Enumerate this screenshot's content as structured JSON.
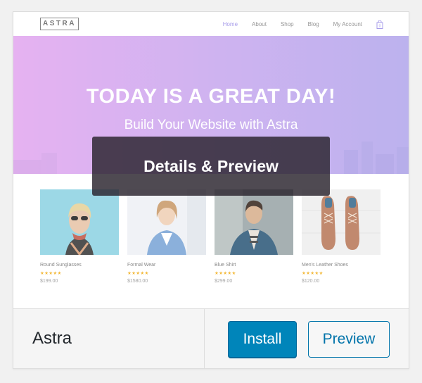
{
  "theme": {
    "name": "Astra"
  },
  "overlay": {
    "label": "Details & Preview"
  },
  "buttons": {
    "install": "Install",
    "preview": "Preview"
  },
  "site": {
    "logo": "ASTRA",
    "nav": [
      "Home",
      "About",
      "Shop",
      "Blog",
      "My Account"
    ],
    "hero_title": "TODAY IS A GREAT DAY!",
    "hero_subtitle": "Build Your Website with Astra"
  },
  "products": [
    {
      "name": "Round Sunglasses",
      "stars": "★★★★★",
      "price": "$199.00"
    },
    {
      "name": "Formal Wear",
      "stars": "★★★★★",
      "price": "$1580.00"
    },
    {
      "name": "Blue Shirt",
      "stars": "★★★★★",
      "price": "$299.00"
    },
    {
      "name": "Men's Leather Shoes",
      "stars": "★★★★★",
      "price": "$120.00"
    }
  ],
  "colors": {
    "install_bg": "#0085ba",
    "preview_border": "#0073aa",
    "hero_start": "#e3a8f0",
    "hero_end": "#b3a8ec",
    "star": "#f2b01e"
  }
}
